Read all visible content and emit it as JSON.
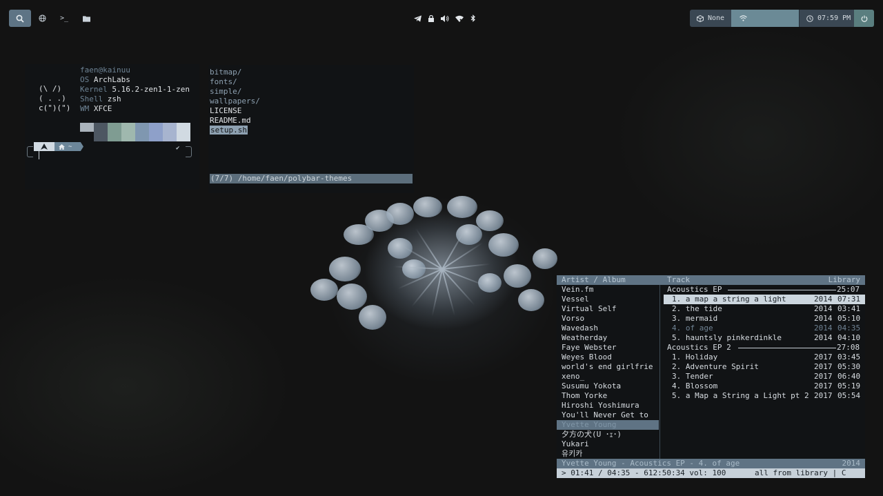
{
  "topbar": {
    "launcher_icons": [
      "search-icon",
      "globe-icon",
      "terminal-icon",
      "folder-icon"
    ],
    "terminal_glyph": ">_",
    "tray_icons": [
      "telegram-icon",
      "lock-icon",
      "volume-icon",
      "network-icon",
      "bluetooth-icon"
    ],
    "vpn_label": "None",
    "time": "07:59 PM"
  },
  "fetch": {
    "user_host": "faen@kainuu",
    "ascii": [
      "(\\ /)",
      "( . .)",
      "c(\")(\")"
    ],
    "rows": [
      {
        "key": "OS",
        "value": "ArchLabs"
      },
      {
        "key": "Kernel",
        "value": "5.16.2-zen1-1-zen"
      },
      {
        "key": "Shell",
        "value": "zsh"
      },
      {
        "key": "WM",
        "value": "XFCE"
      }
    ],
    "swatches": [
      "#aab3bb",
      "#4d5762",
      "#7f9c92",
      "#9fb8ae",
      "#7f97b0",
      "#8ea0c9",
      "#a7b4cf",
      "#d1dae2"
    ],
    "prompt_dir": "~"
  },
  "file_manager": {
    "dirs": [
      "bitmap/",
      "fonts/",
      "simple/",
      "wallpapers/"
    ],
    "files": [
      "LICENSE",
      "README.md"
    ],
    "selected": "setup.sh",
    "status": "(7/7) /home/faen/polybar-themes"
  },
  "music": {
    "header": {
      "col1": "Artist / Album",
      "col2": "Track",
      "col3": "Library"
    },
    "artists": [
      "Vein.fm",
      "Vessel",
      "Virtual Self",
      "Vorso",
      "Wavedash",
      "Weatherday",
      "Faye Webster",
      "Weyes Blood",
      "world's end girlfrie",
      "xeno_",
      "Susumu Yokota",
      "Thom Yorke",
      "Hiroshi Yoshimura",
      "You'll Never Get to",
      "Yvette Young",
      "夕方の犬(U ･ｪ･)",
      "Yukari",
      "유키카"
    ],
    "active_artist_index": 14,
    "albums": [
      {
        "name": "Acoustics EP",
        "total": "25:07",
        "tracks": [
          {
            "title": "1. a map a string a light",
            "year": "2014",
            "duration": "07:31",
            "state": "selected"
          },
          {
            "title": "2. the tide",
            "year": "2014",
            "duration": "03:41",
            "state": "normal"
          },
          {
            "title": "3. mermaid",
            "year": "2014",
            "duration": "05:10",
            "state": "normal"
          },
          {
            "title": "4. of age",
            "year": "2014",
            "duration": "04:35",
            "state": "playing"
          },
          {
            "title": "5. hauntsly pinkerdinkle",
            "year": "2014",
            "duration": "04:10",
            "state": "normal"
          }
        ]
      },
      {
        "name": "Acoustics EP 2",
        "total": "27:08",
        "tracks": [
          {
            "title": "1. Holiday",
            "year": "2017",
            "duration": "03:45",
            "state": "normal"
          },
          {
            "title": "2. Adventure Spirit",
            "year": "2017",
            "duration": "05:30",
            "state": "normal"
          },
          {
            "title": "3. Tender",
            "year": "2017",
            "duration": "06:40",
            "state": "normal"
          },
          {
            "title": "4. Blossom",
            "year": "2017",
            "duration": "05:19",
            "state": "normal"
          },
          {
            "title": "5. a Map a String a Light pt 2",
            "year": "2017",
            "duration": "05:54",
            "state": "normal"
          }
        ]
      }
    ],
    "now_playing": {
      "text": "Yvette Young - Acoustics EP -  4. of age",
      "year": "2014"
    },
    "command_line": {
      "left": "> 01:41 / 04:35 - 612:50:34 vol: 100",
      "right": "all from library | C"
    }
  }
}
